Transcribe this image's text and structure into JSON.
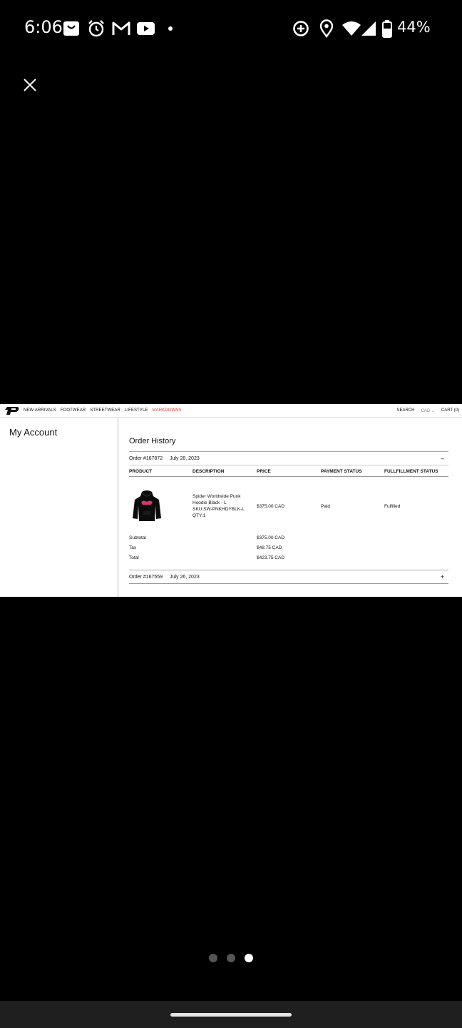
{
  "status_bar": {
    "time": "6:06",
    "battery_percent": "44%",
    "notification_icons": [
      "shopping-bag-icon",
      "alarm-icon",
      "gmail-icon",
      "youtube-icon",
      "dot-icon"
    ],
    "system_icons": [
      "data-saver-icon",
      "location-icon",
      "wifi-icon",
      "signal-icon",
      "battery-icon"
    ]
  },
  "viewer": {
    "close_icon": "close-icon"
  },
  "site": {
    "nav": {
      "links": [
        "NEW ARRIVALS",
        "FOOTWEAR",
        "STREETWEAR",
        "LIFESTYLE",
        "MARKDOWNS"
      ],
      "search": "SEARCH",
      "currency": "CAD",
      "cart": "CART (0)"
    },
    "sidebar": {
      "title": "My Account"
    },
    "order_history": {
      "title": "Order History",
      "columns": [
        "PRODUCT",
        "DESCRIPTION",
        "PRICE",
        "PAYMENT STATUS",
        "FULLFILLMENT STATUS"
      ],
      "orders": [
        {
          "number": "Order #167872",
          "date": "July 28, 2023",
          "toggle": "–",
          "item": {
            "name": "Spider Worldwide Punk Hoodie Black - L",
            "sku": "SKU:SW-PNKHDYBLK-L",
            "qty": "QTY:1",
            "price": "$375.00 CAD",
            "payment_status": "Paid",
            "fulfillment_status": "Fulfilled"
          },
          "subtotal_label": "Subtotal",
          "subtotal": "$375.00 CAD",
          "tax_label": "Tax",
          "tax": "$48.75 CAD",
          "total_label": "Total",
          "total": "$423.75 CAD"
        },
        {
          "number": "Order #167559",
          "date": "July 26, 2023",
          "toggle": "+"
        }
      ]
    }
  },
  "pager": {
    "count": 3,
    "active_index": 2
  },
  "colors": {
    "markdowns": "#e0372a",
    "background": "#000000",
    "nav_bar": "#1f1f1f"
  }
}
